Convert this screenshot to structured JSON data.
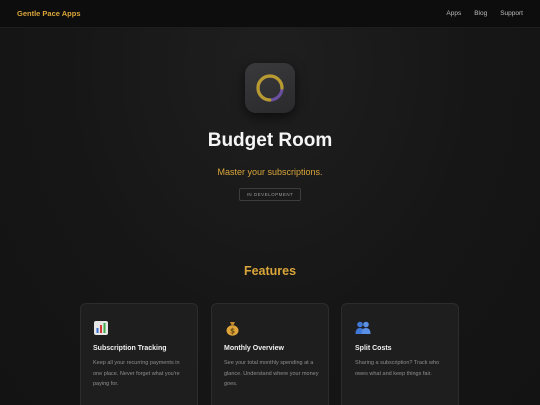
{
  "nav": {
    "brand": "Gentle Pace Apps",
    "links": [
      "Apps",
      "Blog",
      "Support"
    ]
  },
  "hero": {
    "icon": "ring-progress-icon",
    "title": "Budget Room",
    "tagline": "Master your subscriptions.",
    "badge": "IN DEVELOPMENT"
  },
  "features": {
    "heading": "Features",
    "cards": [
      {
        "icon": "bar-chart-icon",
        "title": "Subscription Tracking",
        "description": "Keep all your recurring payments in one place. Never forget what you're paying for."
      },
      {
        "icon": "money-bag-icon",
        "title": "Monthly Overview",
        "description": "See your total monthly spending at a glance. Understand where your money goes."
      },
      {
        "icon": "people-icon",
        "title": "Split Costs",
        "description": "Sharing a subscription? Track who owes what and keep things fair."
      }
    ]
  },
  "colors": {
    "accent": "#d9a53a",
    "background": "#151515",
    "card": "#1e1e1e",
    "ring_gold": "#b89b2e",
    "ring_purple": "#6a4fa0"
  }
}
